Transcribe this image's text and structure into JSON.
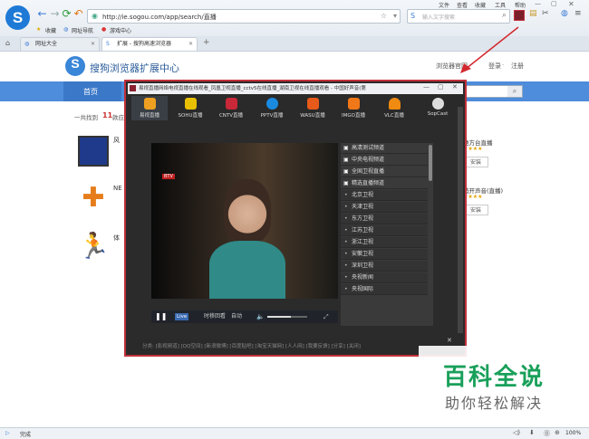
{
  "browser": {
    "menu": [
      "文件",
      "查看",
      "收藏",
      "工具",
      "帮助"
    ],
    "url": "http://ie.sogou.com/app/search/直播",
    "search_placeholder": "输入文字搜索",
    "bookmarks": [
      "收藏",
      "网址导航",
      "游戏中心"
    ],
    "tabs": [
      {
        "label": "网址大全"
      },
      {
        "label": "扩展 - 搜狗高速浏览器"
      }
    ],
    "status": {
      "left": "完成",
      "zoom": "100%"
    }
  },
  "page": {
    "brand": "搜狗浏览器扩展中心",
    "home_link": "浏览器官网",
    "login": "登录",
    "register": "注册",
    "nav_home": "首页",
    "found_prefix": "一共找到",
    "found_count": "11",
    "found_suffix": "款应",
    "left_items": [
      "风",
      "NE",
      "体"
    ],
    "right_items": [
      "地方台直播",
      "萌开声音(直播)"
    ],
    "install": "安装"
  },
  "popup": {
    "title": "易视直播网络电视直播在线观看_凤凰卫视直播_cctv5在线直播_湖南卫视在线直播观看 - 中国好声音(第",
    "sources": [
      "易视直播",
      "SOHU直播",
      "CNTV直播",
      "PPTV直播",
      "WASU直播",
      "IMGO直播",
      "VLC直播",
      "SopCast"
    ],
    "channels": [
      "高清测试频道",
      "中央电视频道",
      "全国卫视直播",
      "精选直播频道",
      "北京卫视",
      "天津卫视",
      "东方卫视",
      "江苏卫视",
      "浙江卫视",
      "安徽卫视",
      "深圳卫视",
      "央视新闻",
      "央视国际"
    ],
    "controls": {
      "live": "Live",
      "time": "时移回看",
      "auto": "自动"
    },
    "footer": "分类: [影视频道] [QQ空间] [新浪微博] [百度贴吧] [淘宝天猫网] [人人网] [我要反馈]   [分享] [关闭]"
  },
  "watermark": {
    "title": "百科全说",
    "subtitle": "助你轻松解决"
  },
  "colors": {
    "accent_blue": "#4e8cdc",
    "highlight_red": "#c0303a",
    "watermark_green": "#19a05a"
  }
}
